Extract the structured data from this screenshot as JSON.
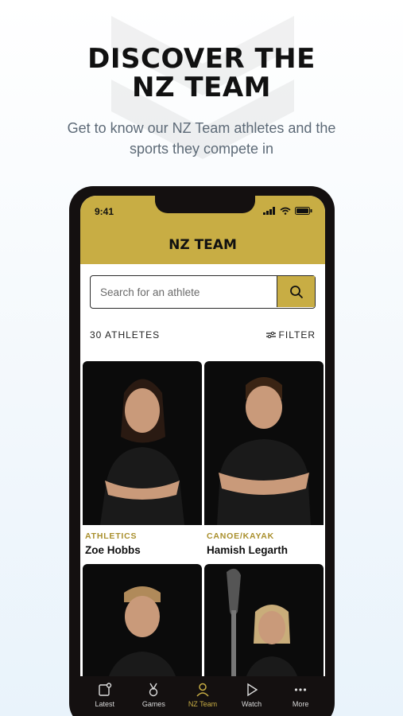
{
  "promo": {
    "headline_line1": "DISCOVER THE",
    "headline_line2": "NZ TEAM",
    "subhead_line1": "Get to know our NZ Team athletes and the",
    "subhead_line2": "sports they compete in"
  },
  "status_bar": {
    "time": "9:41"
  },
  "app": {
    "title": "NZ TEAM",
    "accent_color": "#c8ad44"
  },
  "search": {
    "placeholder": "Search for an athlete"
  },
  "list": {
    "count_label": "30 ATHLETES",
    "filter_label": "FILTER"
  },
  "athletes": [
    {
      "sport": "ATHLETICS",
      "name": "Zoe Hobbs"
    },
    {
      "sport": "CANOE/KAYAK",
      "name": "Hamish Legarth"
    },
    {
      "sport": "",
      "name": ""
    },
    {
      "sport": "",
      "name": ""
    }
  ],
  "tabs": [
    {
      "label": "Latest",
      "icon": "latest-icon"
    },
    {
      "label": "Games",
      "icon": "medal-icon"
    },
    {
      "label": "NZ Team",
      "icon": "team-icon",
      "active": true
    },
    {
      "label": "Watch",
      "icon": "play-icon"
    },
    {
      "label": "More",
      "icon": "more-icon"
    }
  ]
}
